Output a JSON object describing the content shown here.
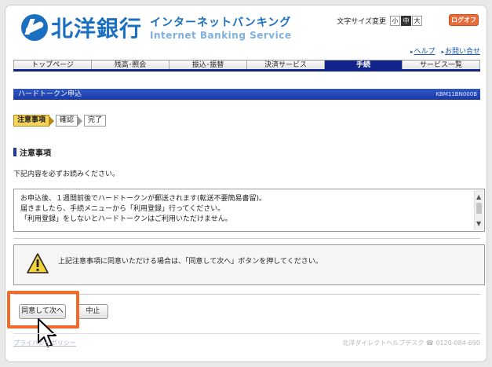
{
  "header": {
    "bank_name": "北洋銀行",
    "service_name_jp": "インターネットバンキング",
    "service_name_en": "Internet Banking Service",
    "font_size_label": "文字サイズ変更",
    "font_sizes": [
      "小",
      "中",
      "大"
    ],
    "logout_label": "ログオフ",
    "help_link": "ヘルプ",
    "contact_link": "お問い合せ"
  },
  "nav": {
    "items": [
      {
        "label": "トップページ",
        "active": false
      },
      {
        "label": "残高･照会",
        "active": false
      },
      {
        "label": "振込･振替",
        "active": false
      },
      {
        "label": "決済サービス",
        "active": false
      },
      {
        "label": "手続",
        "active": true
      },
      {
        "label": "サービス一覧",
        "active": false
      }
    ]
  },
  "page": {
    "title": "ハードトークン申込",
    "screen_id": "KBM11BN000B"
  },
  "steps": [
    "注意事項",
    "確認",
    "完了"
  ],
  "section": {
    "heading": "注意事項",
    "intro": "下記内容を必ずお読みください。"
  },
  "notice": {
    "lines": [
      "お申込後、１週間前後でハードトークンが郵送されます(転送不要簡易書留)。",
      "届きましたら、手続メニューから「利用登録」行ってください。",
      "「利用登録」をしないとハードトークンはご利用いただけません。"
    ]
  },
  "warning": {
    "text": "上記注意事項に同意いただける場合は、「同意して次へ」ボタンを押してください。"
  },
  "buttons": {
    "agree_next": "同意して次へ",
    "cancel": "中止"
  },
  "footer": {
    "privacy": "プライバシーポリシー",
    "helpdesk": "北洋ダイレクトヘルプデスク ☎ 0120-084-690"
  },
  "colors": {
    "brand_blue": "#1a6fc0",
    "nav_active": "#12248a",
    "highlight": "#f26a2a",
    "logout": "#e66a3a"
  }
}
